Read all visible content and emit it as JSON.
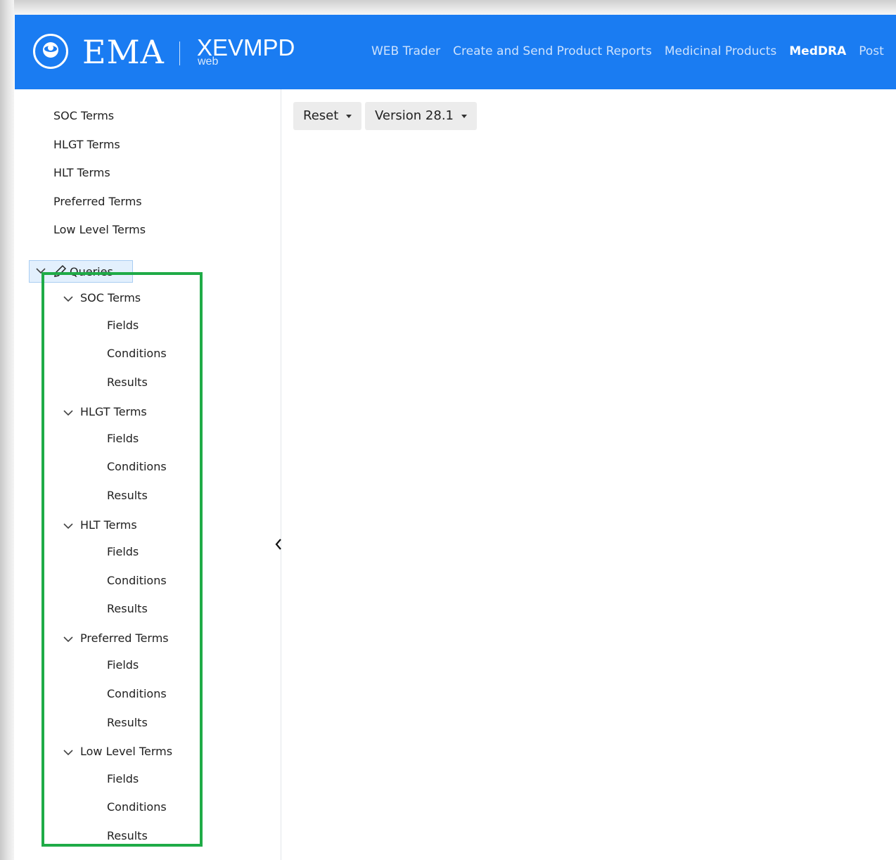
{
  "header": {
    "brand": "EMA",
    "product": "XEVMPD",
    "product_sub": "web",
    "nav": [
      "WEB Trader",
      "Create and Send Product Reports",
      "Medicinal Products",
      "MedDRA",
      "Post"
    ],
    "active_nav": "MedDRA",
    "background_color": "#1a7cf2"
  },
  "sidebar": {
    "top_items": [
      "SOC Terms",
      "HLGT Terms",
      "HLT Terms",
      "Preferred Terms",
      "Low Level Terms"
    ],
    "queries": {
      "label": "Queries",
      "groups": [
        {
          "label": "SOC Terms",
          "children": [
            "Fields",
            "Conditions",
            "Results"
          ]
        },
        {
          "label": "HLGT Terms",
          "children": [
            "Fields",
            "Conditions",
            "Results"
          ]
        },
        {
          "label": "HLT Terms",
          "children": [
            "Fields",
            "Conditions",
            "Results"
          ]
        },
        {
          "label": "Preferred Terms",
          "children": [
            "Fields",
            "Conditions",
            "Results"
          ]
        },
        {
          "label": "Low Level Terms",
          "children": [
            "Fields",
            "Conditions",
            "Results"
          ]
        }
      ]
    },
    "highlight_color": "#1fab47"
  },
  "toolbar": {
    "reset_label": "Reset",
    "version_label": "Version 28.1"
  }
}
